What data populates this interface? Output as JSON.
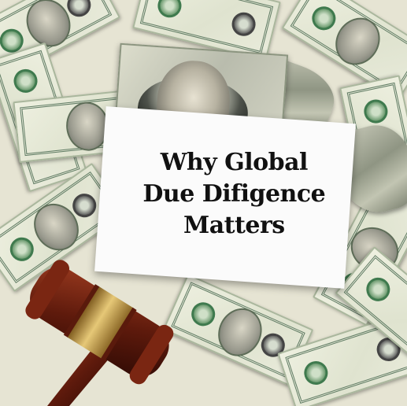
{
  "card": {
    "line1": "Why Global",
    "line2": "Due Difigence",
    "line3": "Matters"
  },
  "colors": {
    "background_bills": "#e6e4d3",
    "bill_green": "#3f7a4e",
    "card": "#fbfbfb",
    "text": "#111111",
    "gavel_wood": "#6a1f10",
    "gavel_band": "#c9a24a"
  }
}
